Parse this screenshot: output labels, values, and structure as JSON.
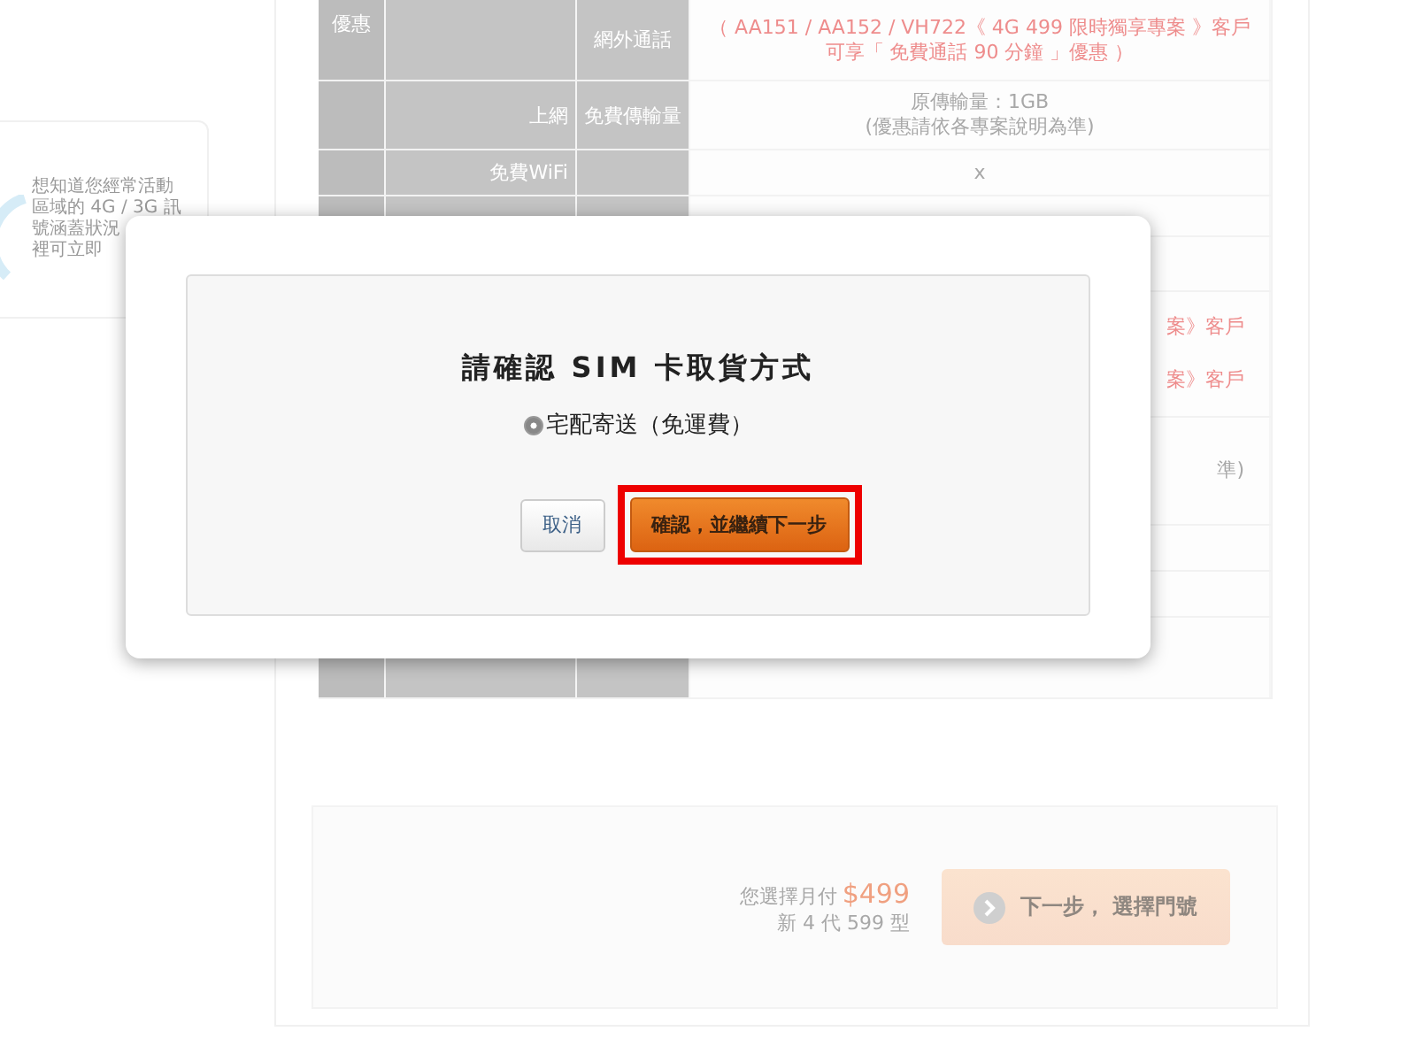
{
  "left_card": {
    "lines": [
      "想知道您經常活動",
      "區域的 4G / 3G 訊",
      "號涵蓋狀況",
      "裡可立即"
    ]
  },
  "table": {
    "rows": [
      {
        "kind": "promo",
        "column_1": "優惠",
        "column_3": "網外通話",
        "value": [
          "（ AA151 / AA152 / VH722《 4G 499 限時獨享專案 》客戶",
          "可享「 免費通話 90 分鐘 」優惠 ）"
        ]
      },
      {
        "kind": "plain",
        "column_2": "上網",
        "column_3": "免費傳輸量",
        "value": [
          "原傳輸量：1GB",
          "(優惠請依各專案說明為準)"
        ]
      },
      {
        "kind": "plain",
        "column_2": "免費WiFi",
        "value": [
          "x"
        ]
      },
      {
        "kind": "plain"
      },
      {
        "kind": "plain"
      },
      {
        "kind": "promo",
        "value": [
          "案》客戶",
          "案》客戶"
        ]
      },
      {
        "kind": "plain",
        "value": [
          "準)"
        ]
      },
      {
        "kind": "plain"
      },
      {
        "kind": "plain"
      },
      {
        "kind": "plain"
      }
    ]
  },
  "summary": {
    "label": "您選擇月付",
    "price": "$499",
    "plan": "新 4 代 599 型",
    "next_button": "下一步， 選擇門號"
  },
  "dialog": {
    "title": "請確認 SIM 卡取貨方式",
    "options": [
      {
        "label": "宅配寄送（免運費）",
        "selected": true
      }
    ],
    "buttons": [
      {
        "kind": "cancel",
        "label": "取消",
        "highlighted": false
      },
      {
        "kind": "confirm",
        "label": "確認，並繼續下一步",
        "highlighted": true
      }
    ]
  }
}
